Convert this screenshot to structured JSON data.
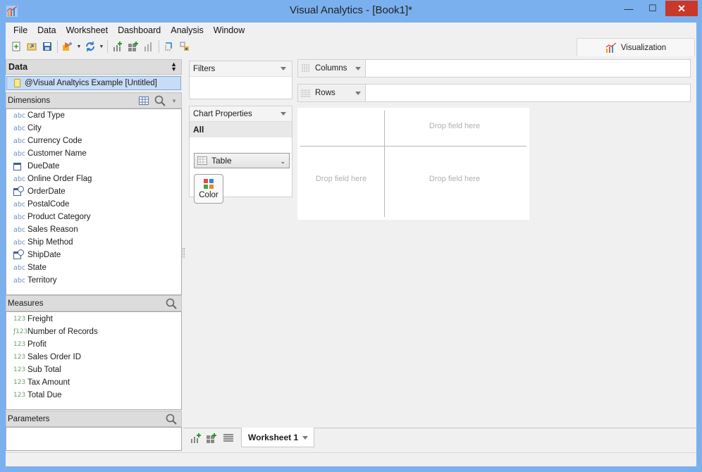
{
  "window": {
    "title": "Visual Analytics - [Book1]*",
    "min_glyph": "—",
    "max_glyph": "☐",
    "close_glyph": "✕"
  },
  "menu": [
    "File",
    "Data",
    "Worksheet",
    "Dashboard",
    "Analysis",
    "Window"
  ],
  "toolbar": {
    "icons": [
      "new-icon",
      "open-icon",
      "save-icon",
      "connect-icon",
      "refresh-icon",
      "new-worksheet-icon",
      "new-dashboard-icon",
      "chart-icon",
      "swap-icon",
      "fit-icon"
    ]
  },
  "visualization_tab": {
    "label": "Visualization"
  },
  "data_panel": {
    "header": "Data",
    "datasource": "@Visual Analtyics Example [Untitled]",
    "dimensions_label": "Dimensions",
    "dimensions": [
      {
        "type": "abc",
        "label": "Card Type"
      },
      {
        "type": "abc",
        "label": "City"
      },
      {
        "type": "abc",
        "label": "Currency Code"
      },
      {
        "type": "abc",
        "label": "Customer Name"
      },
      {
        "type": "date",
        "label": "DueDate"
      },
      {
        "type": "abc",
        "label": "Online Order Flag"
      },
      {
        "type": "datetime",
        "label": "OrderDate"
      },
      {
        "type": "abc",
        "label": "PostalCode"
      },
      {
        "type": "abc",
        "label": "Product Category"
      },
      {
        "type": "abc",
        "label": "Sales Reason"
      },
      {
        "type": "abc",
        "label": "Ship Method"
      },
      {
        "type": "datetime",
        "label": "ShipDate"
      },
      {
        "type": "abc",
        "label": "State"
      },
      {
        "type": "abc",
        "label": "Territory"
      }
    ],
    "measures_label": "Measures",
    "measures": [
      {
        "type": "123",
        "label": "Freight"
      },
      {
        "type": "f123",
        "label": "Number of Records"
      },
      {
        "type": "123",
        "label": "Profit"
      },
      {
        "type": "123",
        "label": "Sales Order ID"
      },
      {
        "type": "123",
        "label": "Sub Total"
      },
      {
        "type": "123",
        "label": "Tax Amount"
      },
      {
        "type": "123",
        "label": "Total Due"
      }
    ],
    "parameters_label": "Parameters"
  },
  "filters": {
    "label": "Filters"
  },
  "chart_properties": {
    "label": "Chart Properties",
    "all_label": "All",
    "chart_type": "Table",
    "color_label": "Color"
  },
  "shelves": {
    "columns_label": "Columns",
    "rows_label": "Rows"
  },
  "canvas": {
    "drop_text": "Drop field here"
  },
  "sheets": {
    "active_tab": "Worksheet 1"
  },
  "colors": {
    "titlebar": "#7ab0ee",
    "close": "#c9392b",
    "selection": "#c7dcf7"
  }
}
